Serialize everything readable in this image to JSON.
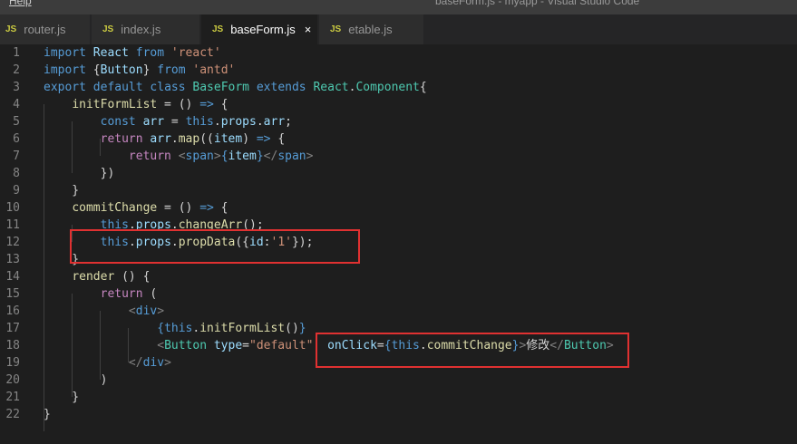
{
  "window": {
    "menu_label": "Help",
    "title": "baseForm.js - myapp - Visual Studio Code"
  },
  "tabs": [
    {
      "icon": "JS",
      "label": "router.js",
      "active": false
    },
    {
      "icon": "JS",
      "label": "index.js",
      "active": false
    },
    {
      "icon": "JS",
      "label": "baseForm.js",
      "active": true,
      "close": "×"
    },
    {
      "icon": "JS",
      "label": "etable.js",
      "active": false
    }
  ],
  "editor": {
    "lines": [
      {
        "n": "1",
        "tokens": [
          [
            "kw",
            "import"
          ],
          [
            "txt",
            " "
          ],
          [
            "var",
            "React"
          ],
          [
            "txt",
            " "
          ],
          [
            "kw",
            "from"
          ],
          [
            "txt",
            " "
          ],
          [
            "str",
            "'react'"
          ]
        ]
      },
      {
        "n": "2",
        "tokens": [
          [
            "kw",
            "import"
          ],
          [
            "txt",
            " {"
          ],
          [
            "var",
            "Button"
          ],
          [
            "txt",
            "} "
          ],
          [
            "kw",
            "from"
          ],
          [
            "txt",
            " "
          ],
          [
            "str",
            "'antd'"
          ]
        ]
      },
      {
        "n": "3",
        "tokens": [
          [
            "kw",
            "export"
          ],
          [
            "txt",
            " "
          ],
          [
            "kw",
            "default"
          ],
          [
            "txt",
            " "
          ],
          [
            "kw",
            "class"
          ],
          [
            "txt",
            " "
          ],
          [
            "type",
            "BaseForm"
          ],
          [
            "txt",
            " "
          ],
          [
            "kw",
            "extends"
          ],
          [
            "txt",
            " "
          ],
          [
            "type",
            "React"
          ],
          [
            "txt",
            "."
          ],
          [
            "type",
            "Component"
          ],
          [
            "txt",
            "{"
          ]
        ]
      },
      {
        "n": "4",
        "tokens": [
          [
            "txt",
            "    "
          ],
          [
            "fn",
            "initFormList"
          ],
          [
            "txt",
            " = () "
          ],
          [
            "kw",
            "=>"
          ],
          [
            "txt",
            " {"
          ]
        ]
      },
      {
        "n": "5",
        "tokens": [
          [
            "txt",
            "        "
          ],
          [
            "kw",
            "const"
          ],
          [
            "txt",
            " "
          ],
          [
            "var",
            "arr"
          ],
          [
            "txt",
            " = "
          ],
          [
            "kw",
            "this"
          ],
          [
            "txt",
            "."
          ],
          [
            "var",
            "props"
          ],
          [
            "txt",
            "."
          ],
          [
            "var",
            "arr"
          ],
          [
            "txt",
            ";"
          ]
        ]
      },
      {
        "n": "6",
        "tokens": [
          [
            "txt",
            "        "
          ],
          [
            "ctl",
            "return"
          ],
          [
            "txt",
            " "
          ],
          [
            "var",
            "arr"
          ],
          [
            "txt",
            "."
          ],
          [
            "fn",
            "map"
          ],
          [
            "txt",
            "(("
          ],
          [
            "var",
            "item"
          ],
          [
            "txt",
            ") "
          ],
          [
            "kw",
            "=>"
          ],
          [
            "txt",
            " {"
          ]
        ]
      },
      {
        "n": "7",
        "tokens": [
          [
            "txt",
            "            "
          ],
          [
            "ctl",
            "return"
          ],
          [
            "txt",
            " "
          ],
          [
            "brk",
            "<"
          ],
          [
            "tag",
            "span"
          ],
          [
            "brk",
            ">"
          ],
          [
            "kw",
            "{"
          ],
          [
            "var",
            "item"
          ],
          [
            "kw",
            "}"
          ],
          [
            "brk",
            "</"
          ],
          [
            "tag",
            "span"
          ],
          [
            "brk",
            ">"
          ]
        ]
      },
      {
        "n": "8",
        "tokens": [
          [
            "txt",
            "        })"
          ]
        ]
      },
      {
        "n": "9",
        "tokens": [
          [
            "txt",
            "    }"
          ]
        ]
      },
      {
        "n": "10",
        "tokens": [
          [
            "txt",
            "    "
          ],
          [
            "fn",
            "commitChange"
          ],
          [
            "txt",
            " = () "
          ],
          [
            "kw",
            "=>"
          ],
          [
            "txt",
            " {"
          ]
        ]
      },
      {
        "n": "11",
        "tokens": [
          [
            "txt",
            "        "
          ],
          [
            "kw",
            "this"
          ],
          [
            "txt",
            "."
          ],
          [
            "var",
            "props"
          ],
          [
            "txt",
            "."
          ],
          [
            "fn",
            "changeArr"
          ],
          [
            "txt",
            "();"
          ]
        ]
      },
      {
        "n": "12",
        "tokens": [
          [
            "txt",
            "        "
          ],
          [
            "kw",
            "this"
          ],
          [
            "txt",
            "."
          ],
          [
            "var",
            "props"
          ],
          [
            "txt",
            "."
          ],
          [
            "fn",
            "propData"
          ],
          [
            "txt",
            "({"
          ],
          [
            "var",
            "id"
          ],
          [
            "txt",
            ":"
          ],
          [
            "str",
            "'1'"
          ],
          [
            "txt",
            "});"
          ]
        ]
      },
      {
        "n": "13",
        "tokens": [
          [
            "txt",
            "    }"
          ]
        ]
      },
      {
        "n": "14",
        "tokens": [
          [
            "txt",
            "    "
          ],
          [
            "fn",
            "render"
          ],
          [
            "txt",
            " () {"
          ]
        ]
      },
      {
        "n": "15",
        "tokens": [
          [
            "txt",
            "        "
          ],
          [
            "ctl",
            "return"
          ],
          [
            "txt",
            " ("
          ]
        ]
      },
      {
        "n": "16",
        "tokens": [
          [
            "txt",
            "            "
          ],
          [
            "brk",
            "<"
          ],
          [
            "tag",
            "div"
          ],
          [
            "brk",
            ">"
          ]
        ]
      },
      {
        "n": "17",
        "tokens": [
          [
            "txt",
            "                "
          ],
          [
            "kw",
            "{"
          ],
          [
            "kw",
            "this"
          ],
          [
            "txt",
            "."
          ],
          [
            "fn",
            "initFormList"
          ],
          [
            "txt",
            "()"
          ],
          [
            "kw",
            "}"
          ]
        ]
      },
      {
        "n": "18",
        "tokens": [
          [
            "txt",
            "                "
          ],
          [
            "brk",
            "<"
          ],
          [
            "type",
            "Button"
          ],
          [
            "txt",
            " "
          ],
          [
            "attr",
            "type"
          ],
          [
            "txt",
            "="
          ],
          [
            "str",
            "\"default\""
          ],
          [
            "txt",
            "  "
          ],
          [
            "attr",
            "onClick"
          ],
          [
            "txt",
            "="
          ],
          [
            "kw",
            "{"
          ],
          [
            "kw",
            "this"
          ],
          [
            "txt",
            "."
          ],
          [
            "fn",
            "commitChange"
          ],
          [
            "kw",
            "}"
          ],
          [
            "brk",
            ">"
          ],
          [
            "txt",
            "修改"
          ],
          [
            "brk",
            "</"
          ],
          [
            "type",
            "Button"
          ],
          [
            "brk",
            ">"
          ]
        ]
      },
      {
        "n": "19",
        "tokens": [
          [
            "txt",
            "            "
          ],
          [
            "brk",
            "</"
          ],
          [
            "tag",
            "div"
          ],
          [
            "brk",
            ">"
          ]
        ]
      },
      {
        "n": "20",
        "tokens": [
          [
            "txt",
            "        )"
          ]
        ]
      },
      {
        "n": "21",
        "tokens": [
          [
            "txt",
            "    }"
          ]
        ]
      },
      {
        "n": "22",
        "tokens": [
          [
            "txt",
            "}"
          ]
        ]
      }
    ]
  },
  "annotations": [
    {
      "label": "highlight-propdata-call"
    },
    {
      "label": "highlight-onclick-handler"
    }
  ]
}
